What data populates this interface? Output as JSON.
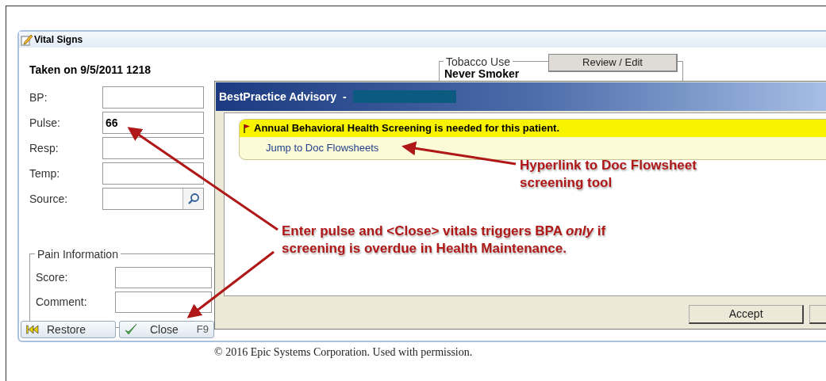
{
  "vital_signs": {
    "title": "Vital Signs",
    "taken_on": "Taken on 9/5/2011 1218",
    "fields": [
      {
        "label": "BP:",
        "kind": "text"
      },
      {
        "label": "Pulse:",
        "kind": "text",
        "value": "66"
      },
      {
        "label": "Resp:",
        "kind": "text"
      },
      {
        "label": "Temp:",
        "kind": "text"
      },
      {
        "label": "Source:",
        "kind": "lookup"
      }
    ],
    "tobacco": {
      "title": "Tobacco Use",
      "button": "Review / Edit",
      "status": "Never Smoker"
    },
    "pain": {
      "title": "Pain Information",
      "fields": [
        {
          "label": "Score:"
        },
        {
          "label": "Comment:"
        }
      ]
    },
    "buttons": [
      {
        "label": "Restore",
        "kind": "restore"
      },
      {
        "label": "Close",
        "kind": "close",
        "shortcut": "F9"
      }
    ]
  },
  "bpa": {
    "title": "BestPractice Advisory  -",
    "alert": "Annual Behavioral Health Screening is needed for this patient.",
    "link": "Jump to Doc Flowsheets",
    "buttons": [
      "Accept"
    ]
  },
  "annotations": [
    {
      "lines": [
        "Hyperlink to Doc Flowsheet",
        "screening tool"
      ]
    },
    {
      "lines": [
        "Enter pulse and <Close> vitals triggers BPA *only* if",
        "screening is overdue in Health Maintenance."
      ]
    }
  ],
  "copyright": "© 2016 Epic Systems Corporation. Used with permission."
}
